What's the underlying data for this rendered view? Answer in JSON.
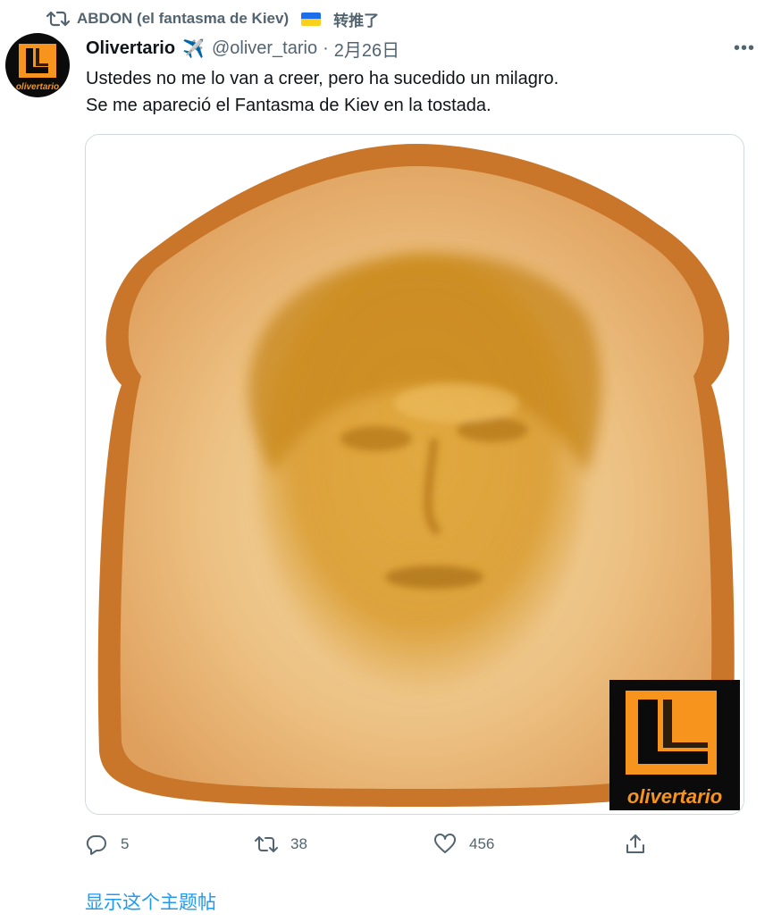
{
  "retweet": {
    "icon": "retweet-icon",
    "retweeter": "ABDON (el fantasma de Kiev)",
    "flag": "ukraine-flag",
    "action_text": "转推了"
  },
  "tweet": {
    "avatar": {
      "icon": "olivertario-logo",
      "logo_text": "olivertario"
    },
    "author_name": "Olivertario",
    "author_emoji": "✈️",
    "handle": "@oliver_tario",
    "separator": "·",
    "date": "2月26日",
    "more_icon": "more-options-icon",
    "text_lines": [
      "Ustedes no me lo van a creer, pero ha sucedido un milagro.",
      "Se me apareció el Fantasma de Kiev en la tostada."
    ],
    "media": {
      "description_icon": "toast-with-face-image",
      "watermark_text": "olivertario"
    },
    "actions": {
      "reply_count": "5",
      "retweet_count": "38",
      "like_count": "456"
    }
  },
  "show_thread_label": "显示这个主题帖",
  "colors": {
    "accent": "#1d9bf0",
    "secondary_text": "#536471",
    "border": "#cfd9de",
    "brand_orange": "#f7941d"
  }
}
